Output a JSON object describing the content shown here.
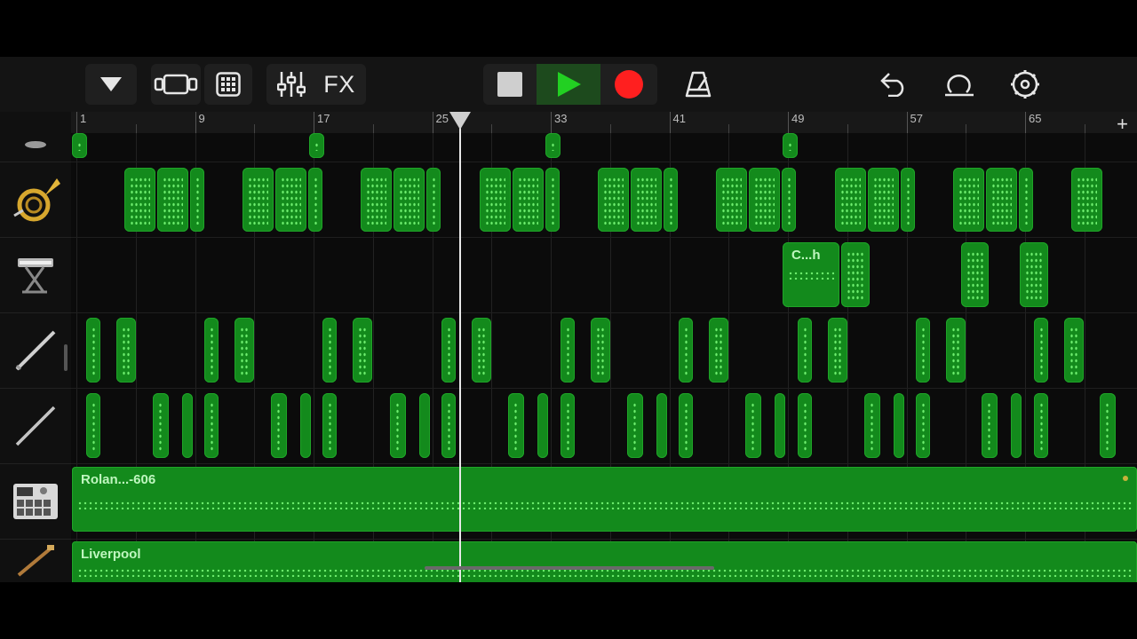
{
  "toolbar": {
    "fx_label": "FX",
    "buttons": [
      "track-menu",
      "tracks-view",
      "live-loops-grid",
      "mixer",
      "fx",
      "stop",
      "play",
      "record",
      "metronome",
      "undo",
      "loop-browser",
      "settings"
    ],
    "colors": {
      "play": "#22d022",
      "record": "#ff1f1f"
    }
  },
  "ruler": {
    "bar_labels": [
      "1",
      "9",
      "17",
      "25",
      "33",
      "41",
      "49",
      "57",
      "65"
    ],
    "add_label": "+"
  },
  "tracks": [
    {
      "instrument": "drum-sampler-icon"
    },
    {
      "instrument": "french-horn-icon"
    },
    {
      "instrument": "keyboard-synth-icon"
    },
    {
      "instrument": "clarinet-icon"
    },
    {
      "instrument": "oboe-icon"
    },
    {
      "instrument": "drum-machine-icon"
    },
    {
      "instrument": "bass-guitar-icon"
    }
  ],
  "regions": {
    "keyboard_region_label": "C...h",
    "drum_region_label": "Rolan...-606",
    "bass_region_label": "Liverpool"
  },
  "playhead_bar": 26
}
